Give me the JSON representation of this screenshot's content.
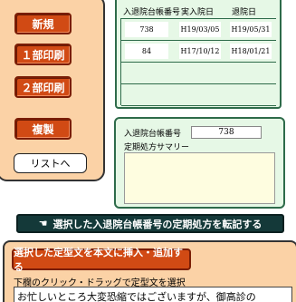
{
  "left_buttons": {
    "new": "新規",
    "print1": "１部印刷",
    "print2": "２部印刷",
    "duplicate": "複製",
    "to_list": "リストへ"
  },
  "admission_table": {
    "headers": {
      "ledger_no": "入退院台帳番号",
      "admit_date": "実入院日",
      "discharge_date": "退院日"
    },
    "rows": [
      {
        "ledger_no": "738",
        "admit_date": "H19/03/05",
        "discharge_date": "H19/05/31"
      },
      {
        "ledger_no": "84",
        "admit_date": "H17/10/12",
        "discharge_date": "H18/01/21"
      },
      {
        "ledger_no": "",
        "admit_date": "",
        "discharge_date": ""
      },
      {
        "ledger_no": "",
        "admit_date": "",
        "discharge_date": ""
      }
    ]
  },
  "summary": {
    "ledger_label": "入退院台帳番号",
    "ledger_value": "738",
    "summary_label": "定期処方サマリー",
    "summary_text": ""
  },
  "transfer_button": {
    "icon": "pointing-hand-icon",
    "label": "選択した入退院台帳番号の定期処方を転記する"
  },
  "template_section": {
    "insert_button": "選択した定型文を本文に挿入・追加する",
    "instruction": "下欄のクリック・ドラッグで定型文を選択",
    "template_text": "お忙しいところ大変恐縮ではございますが、御高診の"
  },
  "colors": {
    "peach_panel": "#fbd2a6",
    "red_button": "#d14a14",
    "green_panel": "#e6f8e6",
    "dark_button": "#143939"
  }
}
